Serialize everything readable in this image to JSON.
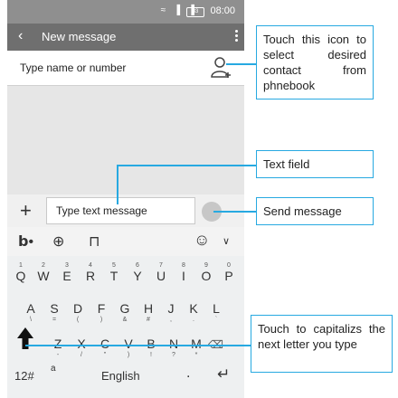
{
  "status_bar": {
    "time": "08:00",
    "battery": "83"
  },
  "app_bar": {
    "back_icon": "arrow-back-icon",
    "title": "New message",
    "menu_icon": "more-vert-icon"
  },
  "recipient": {
    "placeholder": "Type name or number",
    "icon": "add-contact-icon"
  },
  "composer": {
    "add_icon": "plus-icon",
    "placeholder": "Type text message",
    "send_icon": "send-icon"
  },
  "keyboard": {
    "toolbar_icons": [
      "handwriting-icon",
      "globe-icon",
      "shirt-icon",
      "smiley-icon",
      "chevron-down-icon"
    ],
    "row1": [
      {
        "key": "Q",
        "num": "1"
      },
      {
        "key": "W",
        "num": "2"
      },
      {
        "key": "E",
        "num": "3"
      },
      {
        "key": "R",
        "num": "4"
      },
      {
        "key": "T",
        "num": "5"
      },
      {
        "key": "Y",
        "num": "6"
      },
      {
        "key": "U",
        "num": "7"
      },
      {
        "key": "I",
        "num": "8"
      },
      {
        "key": "O",
        "num": "9"
      },
      {
        "key": "P",
        "num": "0"
      }
    ],
    "row2": [
      {
        "key": "A",
        "sym": "\\"
      },
      {
        "key": "S",
        "sym": "="
      },
      {
        "key": "D",
        "sym": "("
      },
      {
        "key": "F",
        "sym": ")"
      },
      {
        "key": "G",
        "sym": "&"
      },
      {
        "key": "H",
        "sym": "#"
      },
      {
        "key": "J",
        "sym": ","
      },
      {
        "key": "K",
        "sym": "."
      },
      {
        "key": "L",
        "sym": "`"
      }
    ],
    "row3": [
      {
        "key": "Z",
        "sym": "-"
      },
      {
        "key": "X",
        "sym": "/"
      },
      {
        "key": "C",
        "sym": "\""
      },
      {
        "key": "V",
        "sym": ")"
      },
      {
        "key": "B",
        "sym": "!"
      },
      {
        "key": "N",
        "sym": "?"
      },
      {
        "key": "M",
        "sym": "*"
      }
    ],
    "symbols_key": "12#",
    "alt_key": "a",
    "space_label": "English",
    "period_key": ".",
    "enter_icon": "enter-icon"
  },
  "callouts": {
    "contact": "Touch this icon to select desired contact from phnebook",
    "text_field": "Text field",
    "send": "Send message",
    "capitalize": "Touch to capitalizs the next letter you type"
  },
  "colors": {
    "callout_line": "#27a9e1",
    "app_bar": "#6f6f6f",
    "status_bar": "#8f8f8f"
  }
}
